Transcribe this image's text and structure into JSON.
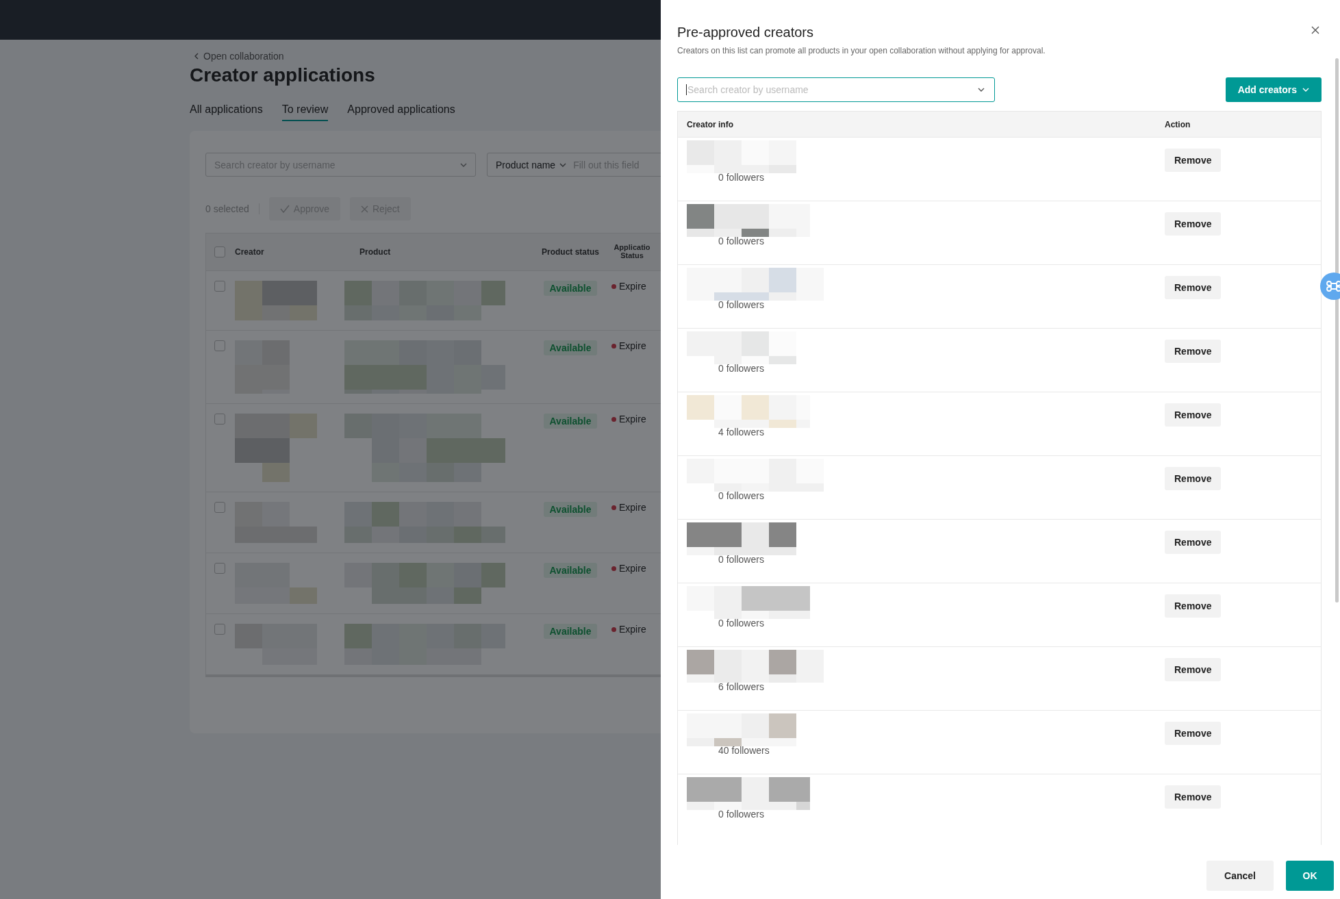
{
  "background_page": {
    "breadcrumb": "Open collaboration",
    "title": "Creator applications",
    "tabs": [
      {
        "label": "All applications",
        "selected": false
      },
      {
        "label": "To review",
        "selected": true
      },
      {
        "label": "Approved applications",
        "selected": false
      }
    ],
    "filters": {
      "search_placeholder": "Search creator by username",
      "product_filter": "Product name",
      "product_placeholder": "Fill out this field"
    },
    "bulk_actions": {
      "selected_count": "0 selected",
      "approve": "Approve",
      "reject": "Reject"
    },
    "table": {
      "select_all_checked": false,
      "columns": [
        "Creator",
        "Product",
        "Product status",
        "Applicatio Status"
      ],
      "rows": [
        {
          "checked": false,
          "product_status": "Available",
          "application_status": "Expire"
        },
        {
          "checked": false,
          "product_status": "Available",
          "application_status": "Expire"
        },
        {
          "checked": false,
          "product_status": "Available",
          "application_status": "Expire"
        },
        {
          "checked": false,
          "product_status": "Available",
          "application_status": "Expire"
        },
        {
          "checked": false,
          "product_status": "Available",
          "application_status": "Expire"
        },
        {
          "checked": false,
          "product_status": "Available",
          "application_status": "Expire"
        }
      ]
    }
  },
  "drawer": {
    "title": "Pre-approved creators",
    "description": "Creators on this list can promote all products in your open collaboration without applying for approval.",
    "search": {
      "placeholder": "Search creator by username"
    },
    "add_button": "Add creators",
    "table": {
      "columns": [
        "Creator info",
        "Action"
      ],
      "rows": [
        {
          "followers": "0 followers",
          "action": "Remove"
        },
        {
          "followers": "0 followers",
          "action": "Remove"
        },
        {
          "followers": "0 followers",
          "action": "Remove"
        },
        {
          "followers": "0 followers",
          "action": "Remove"
        },
        {
          "followers": "4 followers",
          "action": "Remove"
        },
        {
          "followers": "0 followers",
          "action": "Remove"
        },
        {
          "followers": "0 followers",
          "action": "Remove"
        },
        {
          "followers": "0 followers",
          "action": "Remove"
        },
        {
          "followers": "6 followers",
          "action": "Remove"
        },
        {
          "followers": "40 followers",
          "action": "Remove"
        },
        {
          "followers": "0 followers",
          "action": "Remove"
        }
      ]
    },
    "buttons": {
      "cancel": "Cancel",
      "ok": "OK"
    }
  }
}
